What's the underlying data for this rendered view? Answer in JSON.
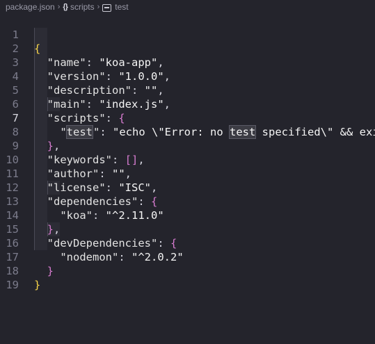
{
  "breadcrumb": {
    "file": "package.json",
    "scripts": "scripts",
    "test": "test"
  },
  "editor": {
    "line_numbers": [
      "1",
      "2",
      "3",
      "4",
      "5",
      "6",
      "7",
      "8",
      "9",
      "10",
      "11",
      "12",
      "13",
      "14",
      "15",
      "16",
      "17",
      "18",
      "19"
    ],
    "active_line": "7",
    "tokens": {
      "open": "{",
      "name_key": "\"name\"",
      "name_val": "\"koa-app\"",
      "version_key": "\"version\"",
      "version_val": "\"1.0.0\"",
      "description_key": "\"description\"",
      "description_val": "\"\"",
      "main_key": "\"main\"",
      "main_val": "\"index.js\"",
      "scripts_key": "\"scripts\"",
      "test_quote_open": "\"",
      "test_word": "test",
      "test_quote_close": "\"",
      "test_val_a": "\"echo \\\"Error: no ",
      "test_val_word": "test",
      "test_val_b": " specified\\\" && exit",
      "keywords_key": "\"keywords\"",
      "keywords_val": "[]",
      "author_key": "\"author\"",
      "author_val": "\"\"",
      "license_key": "\"license\"",
      "license_val": "\"ISC\"",
      "dependencies_key": "\"dependencies\"",
      "koa_key": "\"koa\"",
      "koa_val": "\"^2.11.0\"",
      "devdeps_key": "\"devDependencies\"",
      "nodemon_key": "\"nodemon\"",
      "nodemon_val": "\"^2.0.2\""
    }
  }
}
